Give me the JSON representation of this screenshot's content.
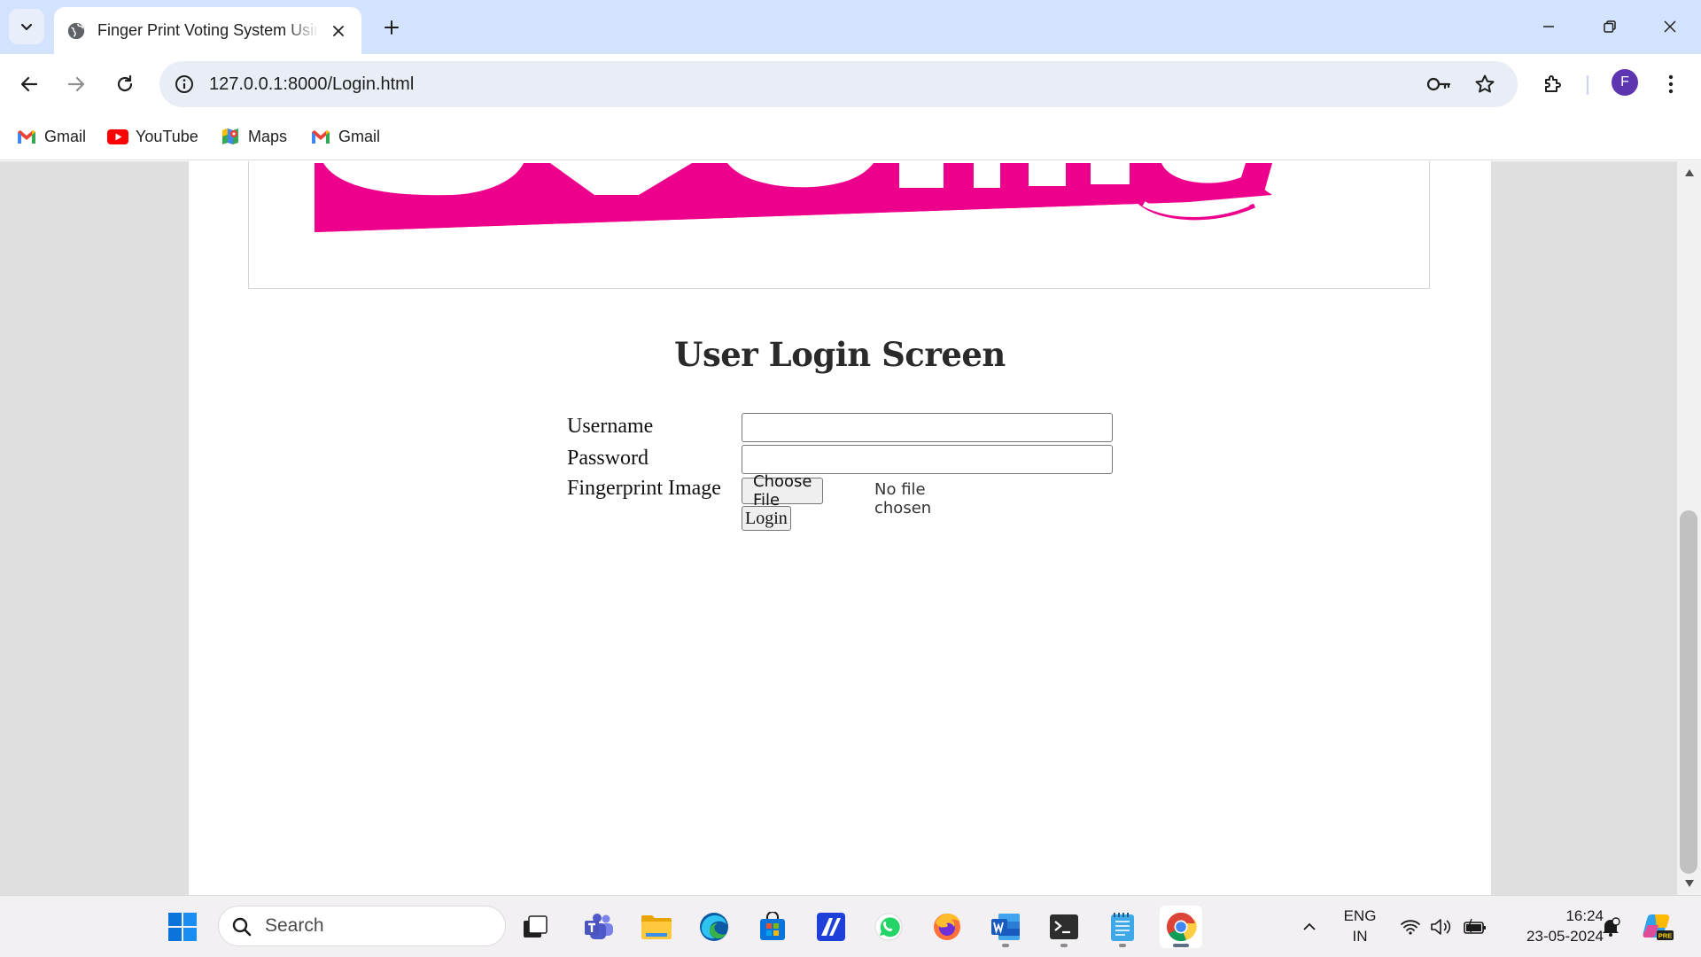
{
  "browser": {
    "tab_title": "Finger Print Voting System Using",
    "url": "127.0.0.1:8000/Login.html",
    "profile_initial": "F",
    "bookmarks": [
      {
        "label": "Gmail",
        "icon": "gmail-icon"
      },
      {
        "label": "YouTube",
        "icon": "youtube-icon"
      },
      {
        "label": "Maps",
        "icon": "maps-icon"
      },
      {
        "label": "Gmail",
        "icon": "gmail-icon"
      }
    ]
  },
  "page": {
    "banner_text": "eVoting",
    "heading": "User Login Screen",
    "form": {
      "username_label": "Username",
      "password_label": "Password",
      "fingerprint_label": "Fingerprint Image",
      "username_value": "",
      "password_value": "",
      "choose_file_label": "Choose File",
      "file_status": "No file chosen",
      "login_label": "Login"
    }
  },
  "taskbar": {
    "search_placeholder": "Search",
    "lang_line1": "ENG",
    "lang_line2": "IN",
    "time": "16:24",
    "date": "23-05-2024",
    "apps": [
      "start",
      "search",
      "task-view",
      "teams",
      "file-explorer",
      "edge",
      "microsoft-store",
      "vs-code-ai",
      "whatsapp",
      "firefox",
      "word",
      "terminal",
      "notepad",
      "chrome"
    ]
  },
  "colors": {
    "tabstrip": "#d3e3fd",
    "omnibox": "#e9eef6",
    "banner_magenta": "#ec008c",
    "avatar": "#5e35b1",
    "page_gutter": "#e0dfdf"
  }
}
